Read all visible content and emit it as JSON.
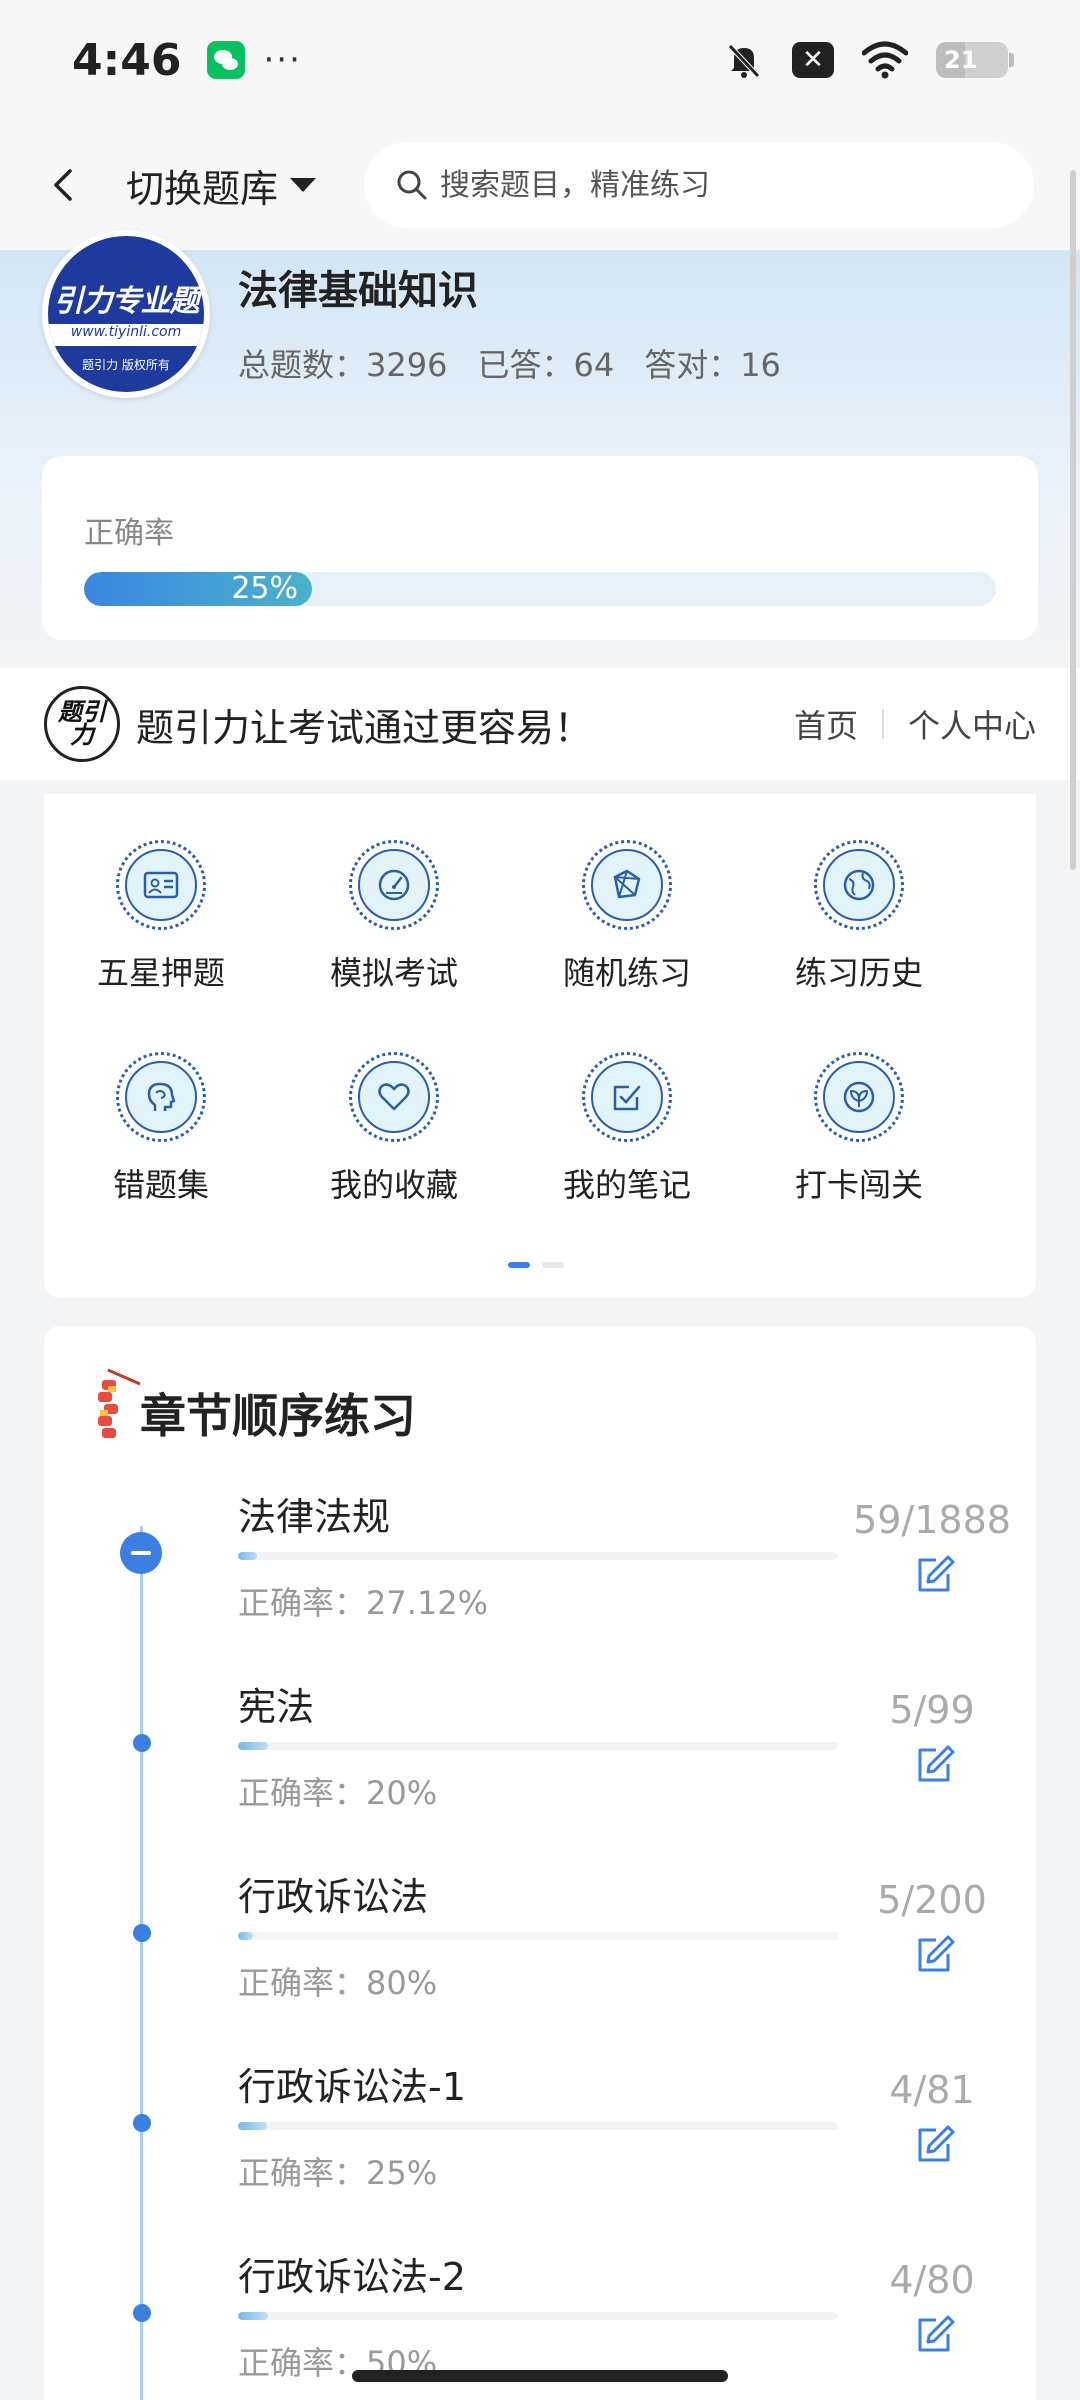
{
  "status_bar": {
    "time": "4:46",
    "more": "···",
    "battery": "21"
  },
  "nav": {
    "switch_label": "切换题库",
    "search_placeholder": "搜索题目，精准练习"
  },
  "bank": {
    "logo_text": "引力专业题",
    "logo_url": "www.tiyinli.com",
    "logo_copy": "题引力 版权所有",
    "title": "法律基础知识",
    "stats": {
      "total": "总题数：3296",
      "answered": "已答：64",
      "correct": "答对：16"
    }
  },
  "accuracy": {
    "label": "正确率",
    "percent_text": "25%",
    "value": 0.25
  },
  "slogan": {
    "logo": "题引力",
    "text": "题引力让考试通过更容易！",
    "links": [
      "首页",
      "个人中心"
    ]
  },
  "features": [
    {
      "label": "五星押题",
      "icon": "id-card-icon"
    },
    {
      "label": "模拟考试",
      "icon": "speedometer-icon"
    },
    {
      "label": "随机练习",
      "icon": "random-cube-icon"
    },
    {
      "label": "练习历史",
      "icon": "globe-icon"
    },
    {
      "label": "错题集",
      "icon": "head-icon"
    },
    {
      "label": "我的收藏",
      "icon": "heart-icon"
    },
    {
      "label": "我的笔记",
      "icon": "check-note-icon"
    },
    {
      "label": "打卡闯关",
      "icon": "leaf-badge-icon"
    }
  ],
  "chapters": {
    "title": "章节顺序练习",
    "items": [
      {
        "name": "法律法规",
        "accuracy": "正确率：27.12%",
        "count": "59/1888",
        "progress": 0.031
      },
      {
        "name": "宪法",
        "accuracy": "正确率：20%",
        "count": "5/99",
        "progress": 0.05
      },
      {
        "name": "行政诉讼法",
        "accuracy": "正确率：80%",
        "count": "5/200",
        "progress": 0.025
      },
      {
        "name": "行政诉讼法-1",
        "accuracy": "正确率：25%",
        "count": "4/81",
        "progress": 0.049
      },
      {
        "name": "行政诉讼法-2",
        "accuracy": "正确率：50%",
        "count": "4/80",
        "progress": 0.05
      }
    ]
  }
}
